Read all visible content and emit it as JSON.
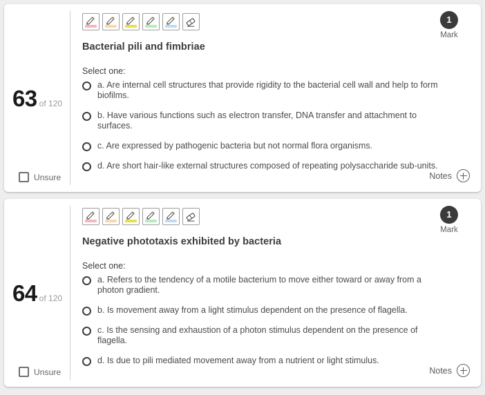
{
  "background_color": "#eeeeee",
  "card_color": "#ffffff",
  "accent_color": "#3b3b3b",
  "toolbar": {
    "tools": [
      {
        "name": "highlighter-pink",
        "label": "Pink highlighter",
        "color": "#f6b6bd"
      },
      {
        "name": "highlighter-orange",
        "label": "Orange highlighter",
        "color": "#fbd7ae"
      },
      {
        "name": "highlighter-yellow",
        "label": "Yellow highlighter",
        "color": "#e4e04f"
      },
      {
        "name": "highlighter-green",
        "label": "Green highlighter",
        "color": "#b4ecbe"
      },
      {
        "name": "highlighter-blue",
        "label": "Blue highlighter",
        "color": "#bcdcf6"
      },
      {
        "name": "eraser",
        "label": "Eraser",
        "color": ""
      }
    ]
  },
  "labels": {
    "of": "of",
    "unsure": "Unsure",
    "mark": "Mark",
    "select_one": "Select one:",
    "notes": "Notes"
  },
  "questions": [
    {
      "number": "63",
      "total": "of 120",
      "mark_value": "1",
      "mark_label": "Mark",
      "unsure_label": "Unsure",
      "unsure_checked": false,
      "stem": "Bacterial pili and fimbriae",
      "select_one": "Select one:",
      "notes_label": "Notes",
      "options": [
        {
          "id": "a",
          "text": "a. Are internal cell structures that provide rigidity to the bacterial cell wall and help to form biofilms.",
          "selected": false
        },
        {
          "id": "b",
          "text": "b. Have various functions such as electron transfer, DNA transfer and attachment to surfaces.",
          "selected": false
        },
        {
          "id": "c",
          "text": "c. Are expressed by pathogenic bacteria but not normal flora organisms.",
          "selected": false
        },
        {
          "id": "d",
          "text": "d. Are short hair-like external structures composed of repeating polysaccharide sub-units.",
          "selected": false
        }
      ]
    },
    {
      "number": "64",
      "total": "of 120",
      "mark_value": "1",
      "mark_label": "Mark",
      "unsure_label": "Unsure",
      "unsure_checked": false,
      "stem": "Negative phototaxis exhibited by bacteria",
      "select_one": "Select one:",
      "notes_label": "Notes",
      "options": [
        {
          "id": "a",
          "text": "a. Refers to the tendency of a motile bacterium to move either toward or away from a photon gradient.",
          "selected": false
        },
        {
          "id": "b",
          "text": "b. Is movement away from a light stimulus dependent on the presence of flagella.",
          "selected": false
        },
        {
          "id": "c",
          "text": "c. Is the sensing and exhaustion of a photon stimulus dependent on the presence of flagella.",
          "selected": false
        },
        {
          "id": "d",
          "text": "d. Is due to pili mediated movement away from a nutrient or light stimulus.",
          "selected": false
        }
      ]
    }
  ]
}
